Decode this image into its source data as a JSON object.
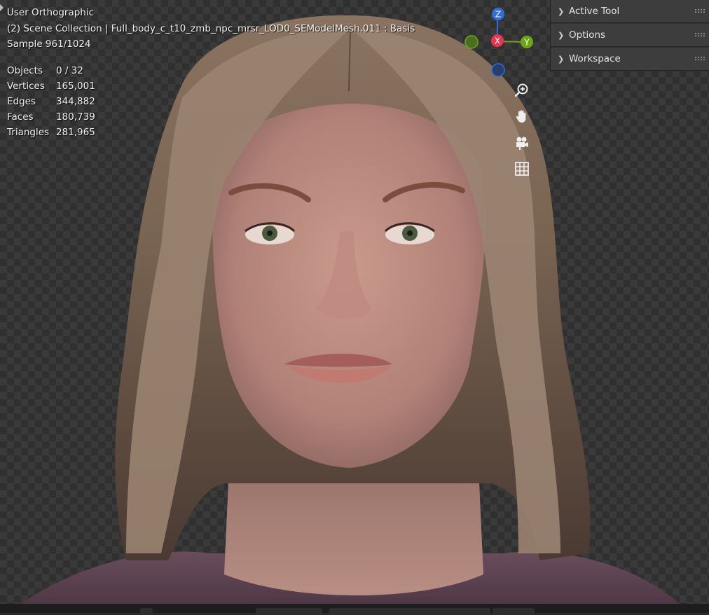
{
  "viewport": {
    "view_name": "User Orthographic",
    "collection_line": "(2) Scene Collection | Full_body_c_t10_zmb_npc_mrsr_LOD0_SEModelMesh.011 : Basis",
    "sample": "Sample 961/1024"
  },
  "stats": [
    {
      "label": "Objects",
      "value": "0 / 32"
    },
    {
      "label": "Vertices",
      "value": "165,001"
    },
    {
      "label": "Edges",
      "value": "344,882"
    },
    {
      "label": "Faces",
      "value": "180,739"
    },
    {
      "label": "Triangles",
      "value": "281,965"
    }
  ],
  "gizmo": {
    "z_label": "Z",
    "x_label": "X",
    "y_label": "Y",
    "colors": {
      "z": "#2f6fd6",
      "x": "#e8354f",
      "y": "#6ca51a"
    }
  },
  "nav_buttons": [
    {
      "icon": "zoom-icon"
    },
    {
      "icon": "pan-hand-icon"
    },
    {
      "icon": "camera-icon"
    },
    {
      "icon": "grid-icon"
    }
  ],
  "side_panel": {
    "rows": [
      {
        "label": "Active Tool"
      },
      {
        "label": "Options"
      },
      {
        "label": "Workspace"
      }
    ]
  }
}
